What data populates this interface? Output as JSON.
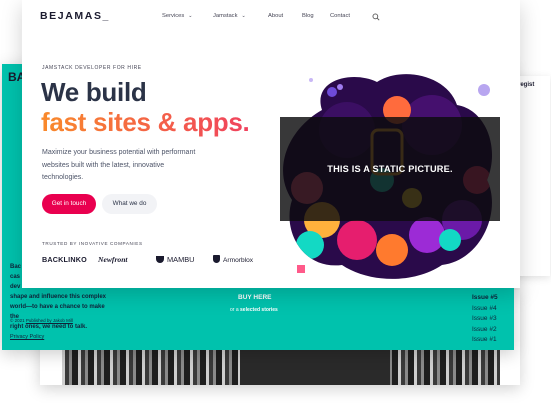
{
  "main": {
    "logo": "BEJAMAS_",
    "nav": [
      {
        "label": "Services",
        "has_dropdown": true
      },
      {
        "label": "Jamstack",
        "has_dropdown": true
      },
      {
        "label": "About",
        "has_dropdown": false
      },
      {
        "label": "Blog",
        "has_dropdown": false
      },
      {
        "label": "Contact",
        "has_dropdown": false
      }
    ],
    "search_icon": "search-icon",
    "eyebrow": "JAMSTACK DEVELOPER FOR HIRE",
    "headline_line1": "We build",
    "headline_line2": "fast sites & apps.",
    "lede": "Maximize your business potential with performant websites built with the latest, innovative technologies.",
    "cta_primary": "Get in touch",
    "cta_secondary": "What we do",
    "trusted_label": "TRUSTED BY INOVATIVE COMPANIES",
    "brands": [
      "BACKLINKO",
      "Newfront",
      "MAMBU",
      "Armorblox"
    ],
    "static_notice": "THIS IS A STATIC PICTURE."
  },
  "teal_card": {
    "logo_fragment": "BA",
    "body_lines": [
      "Bac",
      "cas",
      "dev",
      "shape and influence this complex",
      "world—to have a chance to make the",
      "right ones, we need to talk."
    ],
    "copyright_prefix": "© 2021 ",
    "copyright_link": "Published by Jakob Mill",
    "privacy": "Privacy Policy",
    "buy_here": "BUY HERE",
    "or_prefix": "or a ",
    "or_link": "selected stories",
    "issues": [
      "Issue #5",
      "Issue #4",
      "Issue #3",
      "Issue #2",
      "Issue #1"
    ]
  },
  "side_panel": {
    "text": "regist"
  },
  "colors": {
    "accent": "#e9004f",
    "teal": "#00c2ad",
    "headline_dark": "#2b3347",
    "gradient_start": "#f98a2b",
    "gradient_end": "#f0425e"
  }
}
